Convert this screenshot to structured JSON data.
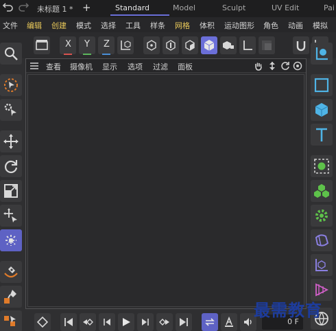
{
  "titlebar": {
    "doc_title": "未标题 1 *",
    "plus": "+",
    "tabs": [
      "Standard",
      "Model",
      "Sculpt",
      "UV Edit",
      "Pai"
    ]
  },
  "menu": {
    "items": [
      "文件",
      "编辑",
      "创建",
      "模式",
      "选择",
      "工具",
      "样条",
      "网格",
      "体积",
      "运动图形",
      "角色",
      "动画",
      "模拟"
    ]
  },
  "toolbar": {
    "x": "X",
    "y": "Y",
    "z": "Z",
    "x_color": "#d9534f",
    "y_color": "#5cb85c",
    "z_color": "#4a8fd8",
    "accent": "#6b6fd8"
  },
  "viewport": {
    "menus": [
      "查看",
      "摄像机",
      "显示",
      "选项",
      "过滤",
      "面板"
    ]
  },
  "timeline": {
    "frame": "0 F"
  },
  "watermark": "最需教育"
}
